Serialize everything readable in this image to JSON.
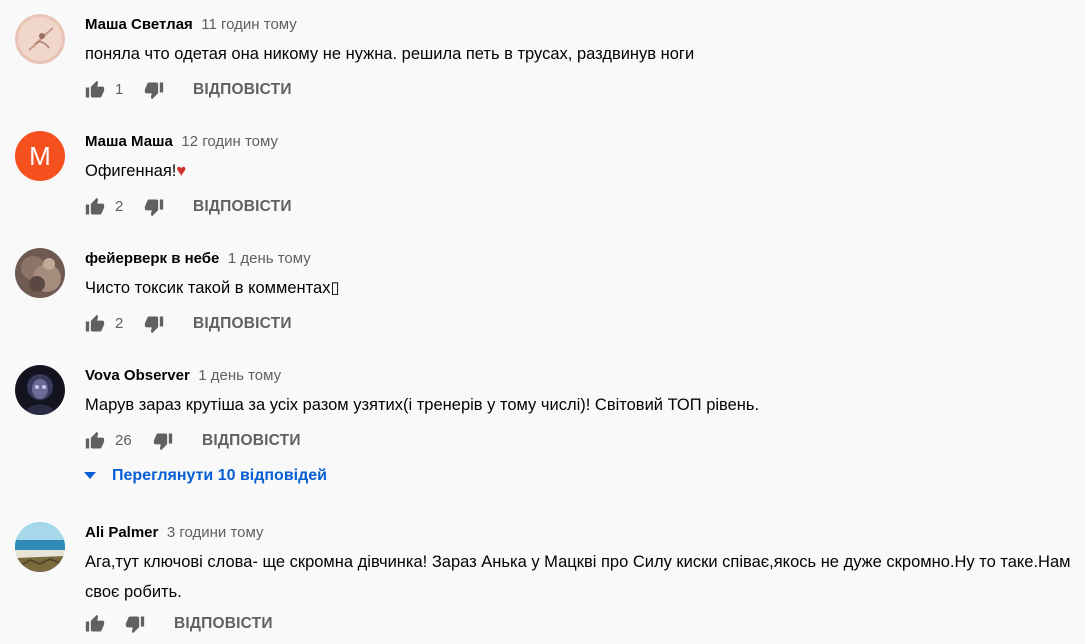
{
  "comments": [
    {
      "author": "Маша Светлая",
      "time": "11 годин тому",
      "text": "поняла что одетая она никому не нужна. решила петь в трусах, раздвинув ноги",
      "likes": "1",
      "reply_label": "ВІДПОВІСТИ"
    },
    {
      "author": "Маша Маша",
      "time": "12 годин тому",
      "avatar_letter": "M",
      "text": "Офигенная!",
      "emoji": "♥",
      "likes": "2",
      "reply_label": "ВІДПОВІСТИ"
    },
    {
      "author": "фейерверк в небе",
      "time": "1 день тому",
      "text": "Чисто токсик такой в комментах▯",
      "likes": "2",
      "reply_label": "ВІДПОВІСТИ"
    },
    {
      "author": "Vova Observer",
      "time": "1 день тому",
      "text": "Марув зараз крутіша за усіх разом узятих(і тренерів у тому числі)! Світовий ТОП рівень.",
      "likes": "26",
      "reply_label": "ВІДПОВІСТИ",
      "view_replies": "Переглянути 10 відповідей"
    },
    {
      "author": "Ali Palmer",
      "time": "3 години тому",
      "text": "Ага,тут ключові слова- ще скромна дівчинка! Зараз Анька у Мацкві про Силу киски співає,якось не дуже скромно.Ну то таке.Нам своє робить.",
      "likes": "",
      "reply_label": "ВІДПОВІСТИ"
    }
  ],
  "icons": {
    "like": "thumb-up-icon",
    "dislike": "thumb-down-icon",
    "expand": "caret-down-icon"
  },
  "colors": {
    "link_blue": "#065fd4",
    "secondary_text": "#606060",
    "avatar_orange": "#f4511e",
    "heart": "#d32f2f"
  }
}
